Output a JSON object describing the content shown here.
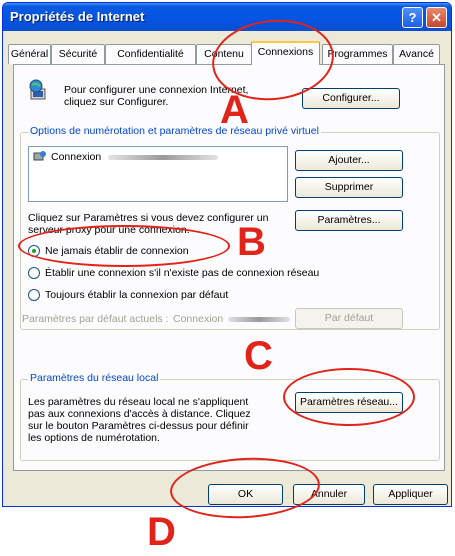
{
  "window": {
    "title": "Propriétés de Internet",
    "help_glyph": "?",
    "close_glyph": "✕"
  },
  "tabs": [
    "Général",
    "Sécurité",
    "Confidentialité",
    "Contenu",
    "Connexions",
    "Programmes",
    "Avancé"
  ],
  "setup": {
    "text_line1": "Pour configurer une connexion Internet,",
    "text_line2": "cliquez sur Configurer.",
    "button": "Configurer..."
  },
  "dialup": {
    "group_title": "Options de numérotation et paramètres de réseau privé virtuel",
    "list_items": [
      {
        "label": "Connexion"
      }
    ],
    "buttons": {
      "add": "Ajouter...",
      "remove": "Supprimer",
      "settings": "Paramètres..."
    },
    "proxy_text_line1": "Cliquez sur Paramètres si vous devez configurer un",
    "proxy_text_line2": "serveur proxy pour une connexion.",
    "options": [
      {
        "label": "Ne jamais établir de connexion",
        "checked": true
      },
      {
        "label": "Établir une connexion s'il n'existe pas de connexion réseau",
        "checked": false
      },
      {
        "label": "Toujours établir la connexion par défaut",
        "checked": false
      }
    ],
    "current_default_label": "Paramètres par défaut actuels :",
    "current_default_value": "Connexion",
    "default_button": "Par défaut"
  },
  "lan": {
    "group_title": "Paramètres du réseau local",
    "text_lines": [
      "Les paramètres du réseau local ne s'appliquent",
      "pas aux connexions d'accès à distance. Cliquez",
      "sur le bouton Paramètres ci-dessus pour définir",
      "les options de numérotation."
    ],
    "button": "Paramètres réseau..."
  },
  "footer": {
    "ok": "OK",
    "cancel": "Annuler",
    "apply": "Appliquer"
  },
  "annotations": {
    "a": "A",
    "b": "B",
    "c": "C",
    "d": "D",
    "color": "#e2231a"
  }
}
